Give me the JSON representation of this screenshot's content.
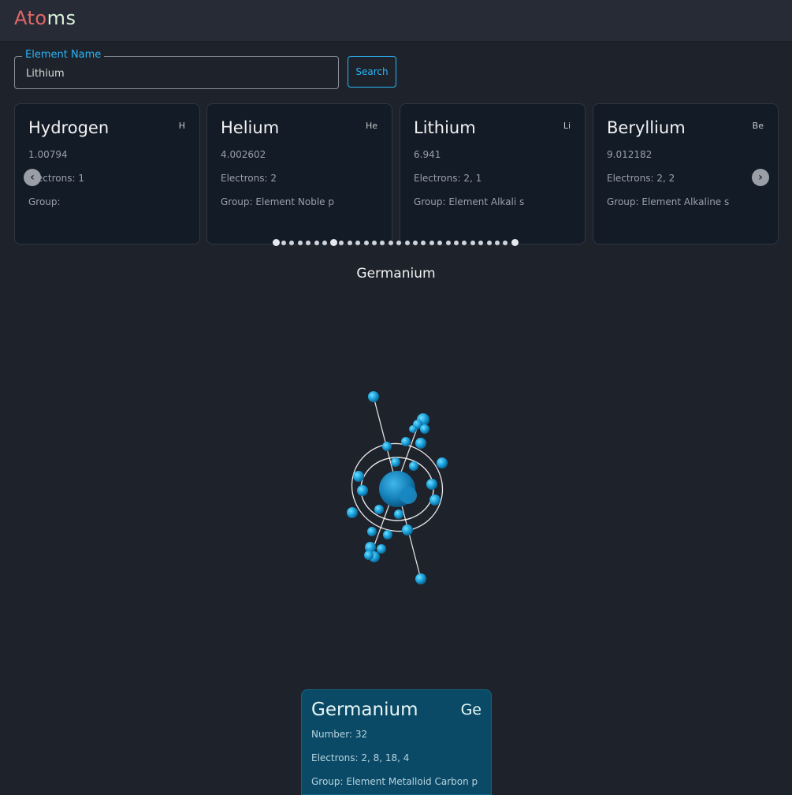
{
  "app": {
    "logo_part1": "Ato",
    "logo_part2": "ms"
  },
  "search": {
    "legend": "Element Name",
    "value": "Lithium",
    "button_label": "Search"
  },
  "carousel": {
    "cards": [
      {
        "name": "Hydrogen",
        "symbol": "H",
        "mass": "1.00794",
        "electrons": "Electrons: 1",
        "group": "Group:"
      },
      {
        "name": "Helium",
        "symbol": "He",
        "mass": "4.002602",
        "electrons": "Electrons: 2",
        "group": "Group: Element Noble p"
      },
      {
        "name": "Lithium",
        "symbol": "Li",
        "mass": "6.941",
        "electrons": "Electrons: 2, 1",
        "group": "Group: Element Alkali s"
      },
      {
        "name": "Beryllium",
        "symbol": "Be",
        "mass": "9.012182",
        "electrons": "Electrons: 2, 2",
        "group": "Group: Element Alkaline s"
      }
    ],
    "prev_icon": "chevron-left-icon",
    "next_icon": "chevron-right-icon",
    "prev_glyph": "‹",
    "next_glyph": "›",
    "page_count": 30,
    "active_pages": [
      1,
      8,
      30
    ]
  },
  "viewer": {
    "title": "Germanium",
    "nucleus_color": "#1e8fc9",
    "electron_color": "#22a8e0",
    "orbit_color": "#ffffff"
  },
  "info": {
    "name": "Germanium",
    "symbol": "Ge",
    "number": "Number: 32",
    "electrons": "Electrons: 2, 8, 18, 4",
    "group": "Group: Element Metalloid Carbon p"
  }
}
